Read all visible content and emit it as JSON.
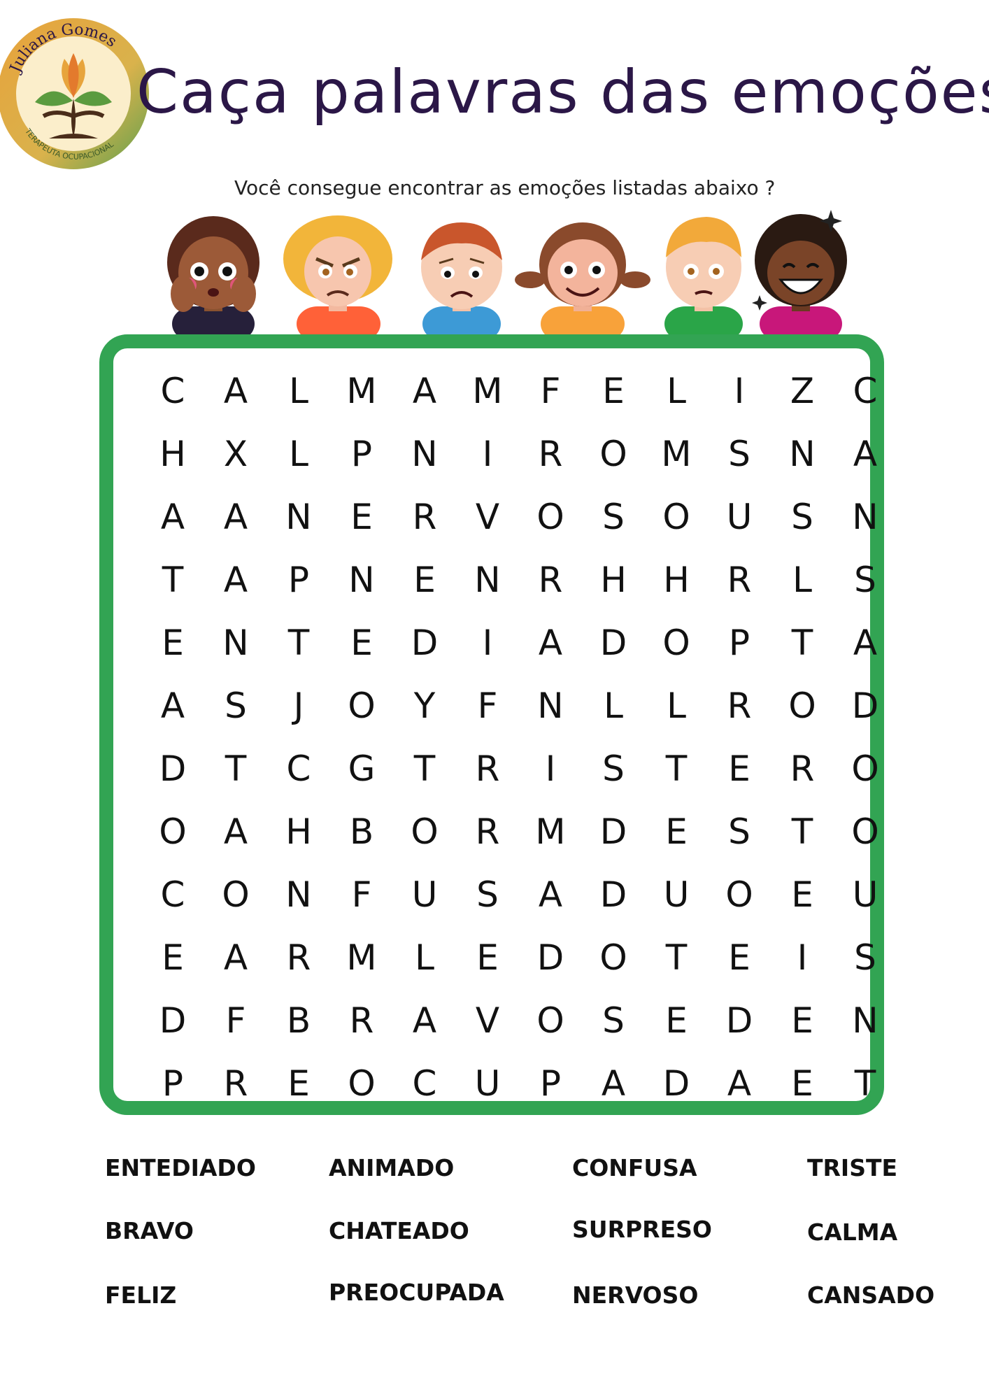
{
  "logo": {
    "name_text": "Juliana Gomes",
    "role_text": "TERAPEUTA OCUPACIONAL"
  },
  "title": "Caça palavras das emoções",
  "subtitle": "Você consegue encontrar as emoções listadas abaixo ?",
  "characters": [
    "worried-girl",
    "angry-girl",
    "sad-boy",
    "happy-girl",
    "upset-boy",
    "laughing-boy"
  ],
  "colors": {
    "frame": "#32a453",
    "title": "#2b1747"
  },
  "grid": [
    [
      "C",
      "A",
      "L",
      "M",
      "A",
      "M",
      "F",
      "E",
      "L",
      "I",
      "Z",
      "C"
    ],
    [
      "H",
      "X",
      "L",
      "P",
      "N",
      "I",
      "R",
      "O",
      "M",
      "S",
      "N",
      "A"
    ],
    [
      "A",
      "A",
      "N",
      "E",
      "R",
      "V",
      "O",
      "S",
      "O",
      "U",
      "S",
      "N"
    ],
    [
      "T",
      "A",
      "P",
      "N",
      "E",
      "N",
      "R",
      "H",
      "H",
      "R",
      "L",
      "S"
    ],
    [
      "E",
      "N",
      "T",
      "E",
      "D",
      "I",
      "A",
      "D",
      "O",
      "P",
      "T",
      "A"
    ],
    [
      "A",
      "S",
      "J",
      "O",
      "Y",
      "F",
      "N",
      "L",
      "L",
      "R",
      "O",
      "D"
    ],
    [
      "D",
      "T",
      "C",
      "G",
      "T",
      "R",
      "I",
      "S",
      "T",
      "E",
      "R",
      "O"
    ],
    [
      "O",
      "A",
      "H",
      "B",
      "O",
      "R",
      "M",
      "D",
      "E",
      "S",
      "T",
      "O"
    ],
    [
      "C",
      "O",
      "N",
      "F",
      "U",
      "S",
      "A",
      "D",
      "U",
      "O",
      "E",
      "U"
    ],
    [
      "E",
      "A",
      "R",
      "M",
      "L",
      "E",
      "D",
      "O",
      "T",
      "E",
      "I",
      "S"
    ],
    [
      "D",
      "F",
      "B",
      "R",
      "A",
      "V",
      "O",
      "S",
      "E",
      "D",
      "E",
      "N"
    ],
    [
      "P",
      "R",
      "E",
      "O",
      "C",
      "U",
      "P",
      "A",
      "D",
      "A",
      "E",
      "T"
    ]
  ],
  "words": [
    "ENTEDIADO",
    "ANIMADO",
    "CONFUSA",
    "TRISTE",
    "BRAVO",
    "CHATEADO",
    "SURPRESO",
    "CALMA",
    "FELIZ",
    "PREOCUPADA",
    "NERVOSO",
    "CANSADO"
  ]
}
